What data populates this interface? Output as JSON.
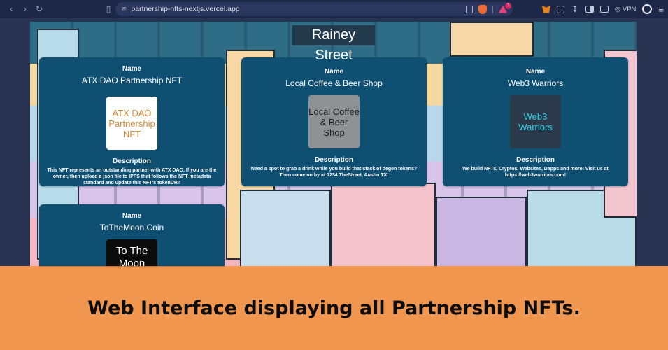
{
  "browser": {
    "url": "partnership-nfts-nextjs.vercel.app",
    "rewards_count": "3",
    "vpn_label": "VPN",
    "icons": [
      "back-icon",
      "forward-icon",
      "reload-icon",
      "bookmark-icon",
      "site-settings-icon",
      "share-icon",
      "brave-shields-icon",
      "brave-rewards-icon",
      "metamask-icon",
      "extensions-icon",
      "downloads-icon",
      "sidebar-icon",
      "wallet-icon",
      "vpn-icon",
      "profile-icon",
      "menu-icon"
    ]
  },
  "page": {
    "title": "Rainey Street",
    "name_label": "Name",
    "description_label": "Description"
  },
  "cards": [
    {
      "name": "ATX DAO Partnership NFT",
      "image_text": "ATX DAO Partnership NFT",
      "image_bg": "#ffffff",
      "image_color": "#d98a36",
      "description": "This NFT represents an outstanding partner with ATX DAO. If you are the owner, then upload a json file to IPFS that follows the NFT metadata standard and update this NFT's tokenURI!"
    },
    {
      "name": "Local Coffee & Beer Shop",
      "image_text": "Local Coffee & Beer Shop",
      "image_bg": "#8f9294",
      "image_color": "#1a1a1a",
      "description": "Need a spot to grab a drink while you build that stack of degen tokens? Then come on by at 1234 TheStreet, Austin TX!"
    },
    {
      "name": "Web3 Warriors",
      "image_text": "Web3 Warriors",
      "image_bg": "#2b3a4a",
      "image_color": "#2fd0e8",
      "description": "We build NFTs, Cryptos, Websites, Dapps and more! Visit us at https://web3warriors.com!"
    },
    {
      "name": "ToTheMoon Coin",
      "image_text": "To The Moon",
      "image_bg": "#0b0b0b",
      "image_color": "#ffffff",
      "description": ""
    }
  ],
  "caption": "Web Interface displaying all Partnership NFTs.",
  "colors": {
    "card_bg": "#0e4f72",
    "caption_bg": "#f0964f",
    "chrome_bg": "#1d2747",
    "page_bg": "#293352"
  }
}
